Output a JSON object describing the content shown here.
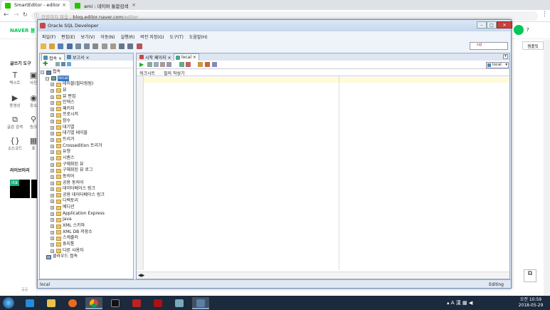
{
  "browser": {
    "tabs": [
      {
        "label": "SmartEditor - editor",
        "active": true
      },
      {
        "label": "ami : 네이버 통합검색",
        "active": false
      }
    ],
    "security_label": "안전하지 않음",
    "url_host": "blog.editor.naver.com",
    "url_path": "/editor"
  },
  "naver": {
    "logo": "NAVER 블",
    "tools_header": "글쓰기 도구",
    "tools": [
      {
        "icon": "T",
        "label": "텍스트"
      },
      {
        "icon": "▣",
        "label": "사진"
      },
      {
        "icon": "▶",
        "label": "동영상"
      },
      {
        "icon": "◉",
        "label": "장소"
      },
      {
        "icon": "⧉",
        "label": "글감 검색"
      },
      {
        "icon": "⚲",
        "label": "링크"
      },
      {
        "icon": "{}",
        "label": "소스코드"
      },
      {
        "icon": "▦",
        "label": "표"
      }
    ],
    "library_header": "라이브러리",
    "library_tag": "대표",
    "help": "?",
    "template_button": "템플릿",
    "bottom_text": "공공"
  },
  "sqldev": {
    "title": "Oracle SQL Developer",
    "menu": [
      "파일(F)",
      "편집(E)",
      "보기(V)",
      "이동(N)",
      "실행(R)",
      "버전 지정(G)",
      "도구(T)",
      "도움말(H)"
    ],
    "search_placeholder": "sql",
    "left_tabs": [
      {
        "label": "접속",
        "active": true
      },
      {
        "label": "보고서",
        "active": false
      }
    ],
    "tree": {
      "root": "접속",
      "connection": "local",
      "nodes": [
        "테이블(필터링됨)",
        "뷰",
        "뷰 편집",
        "인덱스",
        "패키지",
        "프로시저",
        "함수",
        "대기열",
        "대기열 테이블",
        "트리거",
        "Crossedition 트리거",
        "유형",
        "시퀀스",
        "구체화된 뷰",
        "구체화된 뷰 로그",
        "동의어",
        "공용 동의어",
        "데이터베이스 링크",
        "공용 데이터베이스 링크",
        "디렉토리",
        "에디션",
        "Application Express",
        "Java",
        "XML 스키마",
        "XML DB 저장소",
        "스케줄러",
        "휴지통",
        "다른 사용자"
      ],
      "cloud": "클라우드 접속"
    },
    "right_tabs": [
      {
        "label": "시작 페이지",
        "active": false
      },
      {
        "label": "local",
        "active": true
      }
    ],
    "connection_select": "local",
    "sub_tabs": [
      "워크시트",
      "질의 작성기"
    ],
    "status_left": "local",
    "status_right": "Editing"
  },
  "taskbar": {
    "time": "오전 10:59",
    "date": "2018-05-29",
    "ime": "A 漢"
  }
}
